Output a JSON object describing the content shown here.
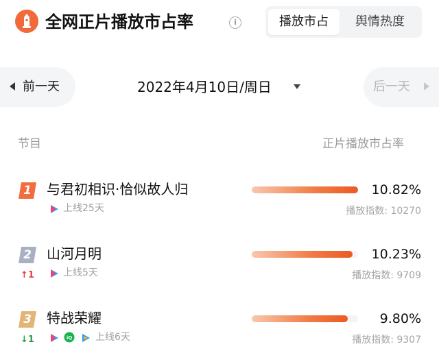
{
  "header": {
    "title": "全网正片播放市占率",
    "info_icon": "info-circle-icon",
    "tabs": [
      {
        "label": "播放市占",
        "active": true
      },
      {
        "label": "舆情热度",
        "active": false
      }
    ]
  },
  "date_bar": {
    "prev_label": "前一天",
    "date": "2022年4月10日/周日",
    "next_label": "后一天"
  },
  "table": {
    "col_program": "节目",
    "col_share": "正片播放市占率",
    "rows": [
      {
        "rank": "1",
        "rank_color": "#f26d3d",
        "change": "",
        "title": "与君初相识·恰似故人归",
        "online": "上线25天",
        "platforms": [
          "youku-icon"
        ],
        "share": "10.82%",
        "share_value": 10.82,
        "index": "播放指数: 10270"
      },
      {
        "rank": "2",
        "rank_color": "#a9b0c2",
        "change": "↑1",
        "title": "山河月明",
        "online": "上线5天",
        "platforms": [
          "youku-icon"
        ],
        "share": "10.23%",
        "share_value": 10.23,
        "index": "播放指数: 9709"
      },
      {
        "rank": "3",
        "rank_color": "#e2b577",
        "change": "↓1",
        "title": "特战荣耀",
        "online": "上线6天",
        "platforms": [
          "youku-icon",
          "iqiyi-icon",
          "tencent-video-icon"
        ],
        "share": "9.80%",
        "share_value": 9.8,
        "index": "播放指数: 9307"
      }
    ]
  },
  "colors": {
    "accent": "#ec5a24",
    "up": "#e0433a",
    "down": "#2f9a4a"
  }
}
